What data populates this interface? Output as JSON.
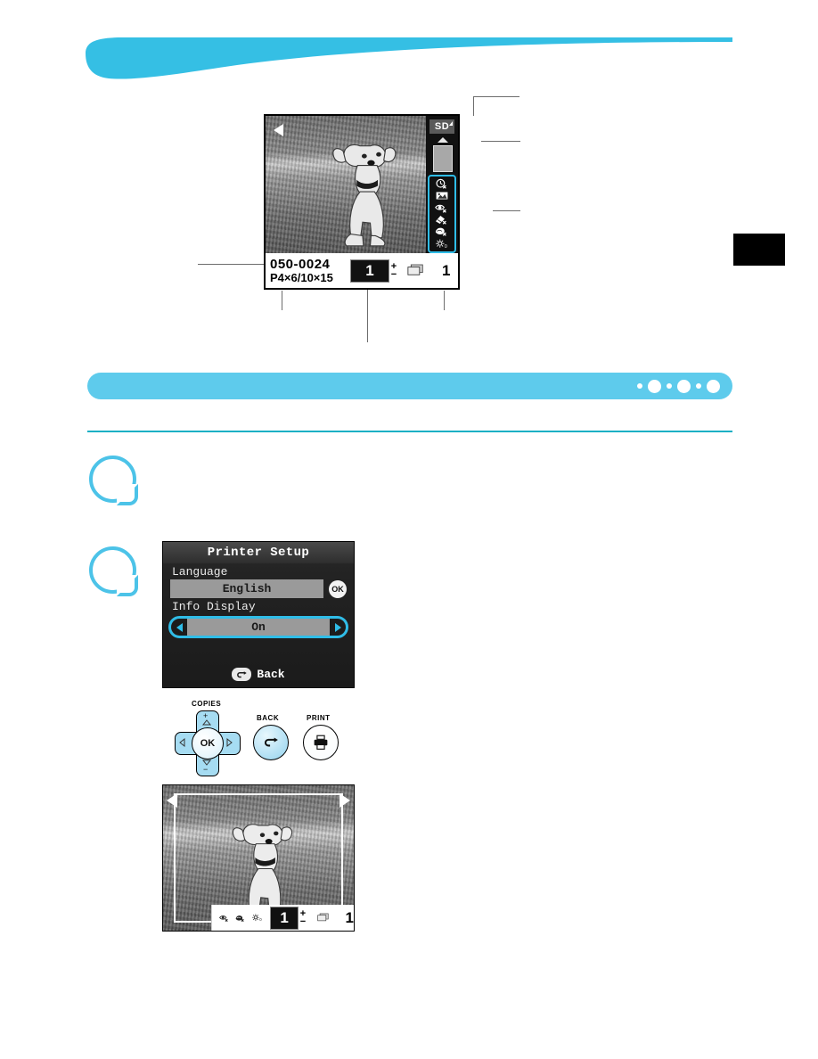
{
  "page": {
    "accent_blue": "#35bfe4",
    "bar_blue": "#5ecbec",
    "rule_color": "#19b0c4",
    "lcd_highlight": "#2fbde8"
  },
  "pagination_dots": [
    {
      "size": "small"
    },
    {
      "size": "large"
    },
    {
      "size": "small"
    },
    {
      "size": "large"
    },
    {
      "size": "small"
    },
    {
      "size": "large"
    }
  ],
  "top_lcd": {
    "nav_left_icon": "triangle-left-icon",
    "nav_right_icon": "triangle-right-icon",
    "file_number": "050-0024",
    "paper_size": "P4×6/10×15",
    "copies_value": "1",
    "plus_label": "+",
    "minus_label": "−",
    "stack_icon": "print-stack-icon",
    "total_prints": "1",
    "status_column": {
      "card_badge": "SD",
      "eject_icon": "eject-triangle-icon",
      "card_icon": "memory-card-icon",
      "icons": [
        {
          "name": "date-print-off-icon",
          "label": "Date print off"
        },
        {
          "name": "file-number-print-icon",
          "label": "File no. print"
        },
        {
          "name": "red-eye-correction-off-icon",
          "label": "Red-eye correction off"
        },
        {
          "name": "trimming-off-icon",
          "label": "Trimming off"
        },
        {
          "name": "image-optimize-off-icon",
          "label": "Image optimize off"
        },
        {
          "name": "brightness-icon",
          "label": "Brightness",
          "value": "0"
        }
      ]
    }
  },
  "menu_lcd": {
    "title": "Printer Setup",
    "items": [
      {
        "label": "Language",
        "value": "English",
        "control": "ok",
        "selected": false
      },
      {
        "label": "Info Display",
        "value": "On",
        "control": "arrows",
        "selected": true
      }
    ],
    "ok_label": "OK",
    "back_label": "Back",
    "back_icon": "return-arrow-icon",
    "left_arrow_icon": "triangle-left-icon",
    "right_arrow_icon": "triangle-right-icon"
  },
  "button_panel": {
    "copies_caption": "COPIES",
    "back_caption": "BACK",
    "print_caption": "PRINT",
    "ok_label": "OK",
    "up_label": "+",
    "down_label": "−",
    "up_icon": "triangle-up-icon",
    "down_icon": "triangle-down-icon",
    "left_icon": "triangle-left-icon",
    "right_icon": "triangle-right-icon",
    "back_icon": "return-arrow-icon",
    "print_icon": "printer-icon"
  },
  "bottom_lcd": {
    "nav_left_icon": "triangle-left-icon",
    "nav_right_icon": "triangle-right-icon",
    "crop_frame": "trimming-frame",
    "icons": [
      {
        "name": "red-eye-correction-off-icon",
        "label": "Red-eye correction off"
      },
      {
        "name": "trimming-off-icon",
        "label": "Trimming off"
      },
      {
        "name": "brightness-icon",
        "label": "Brightness",
        "value": "0"
      }
    ],
    "copies_value": "1",
    "plus_label": "+",
    "minus_label": "−",
    "stack_icon": "print-stack-icon",
    "total_prints": "1"
  }
}
